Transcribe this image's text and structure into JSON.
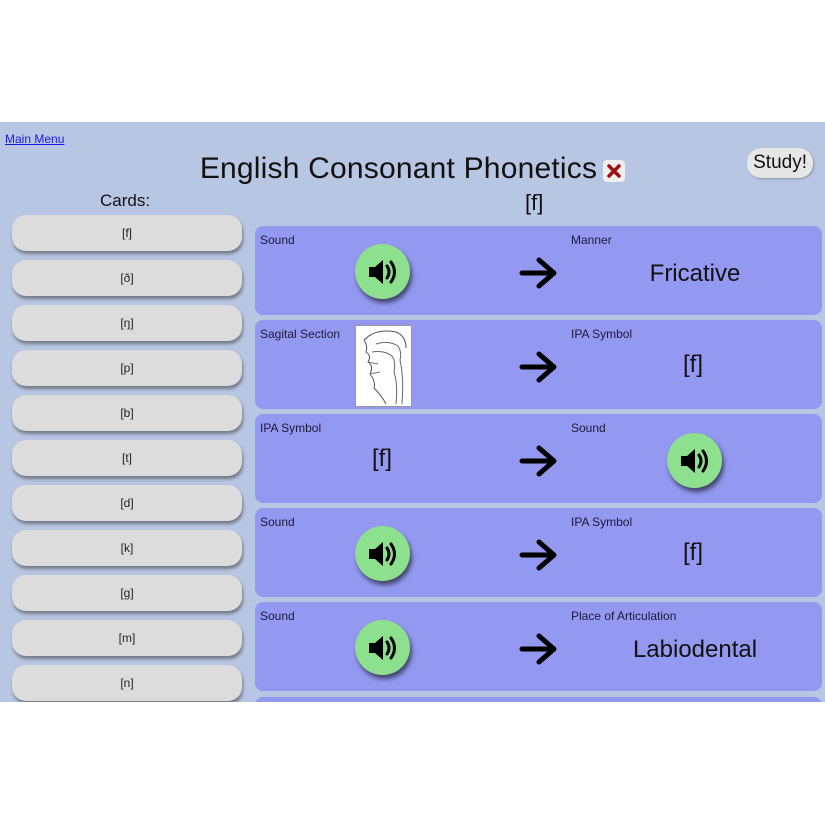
{
  "nav": {
    "main_menu": "Main Menu"
  },
  "header": {
    "title": "English Consonant Phonetics",
    "study_label": "Study!"
  },
  "cards_label": "Cards:",
  "current_card": "[f]",
  "cards": [
    "[f]",
    "[ð]",
    "[ŋ]",
    "[p]",
    "[b]",
    "[t]",
    "[d]",
    "[k]",
    "[g]",
    "[m]",
    "[n]"
  ],
  "panels": [
    {
      "left_label": "Sound",
      "right_label": "Manner",
      "right_value": "Fricative"
    },
    {
      "left_label": "Sagital Section",
      "right_label": "IPA Symbol",
      "right_value": "[f]"
    },
    {
      "left_label": "IPA Symbol",
      "left_value": "[f]",
      "right_label": "Sound"
    },
    {
      "left_label": "Sound",
      "right_label": "IPA Symbol",
      "right_value": "[f]"
    },
    {
      "left_label": "Sound",
      "right_label": "Place of Articulation",
      "right_value": "Labiodental"
    }
  ],
  "colors": {
    "app_bg": "#b7c6e3",
    "panel_bg": "#9399f0",
    "sound_button": "#8de08d",
    "card_button": "#dcdcdc",
    "close_x": "#a01010"
  },
  "icons": {
    "sound": "speaker-icon",
    "arrow": "arrow-right-icon",
    "close": "close-icon"
  }
}
